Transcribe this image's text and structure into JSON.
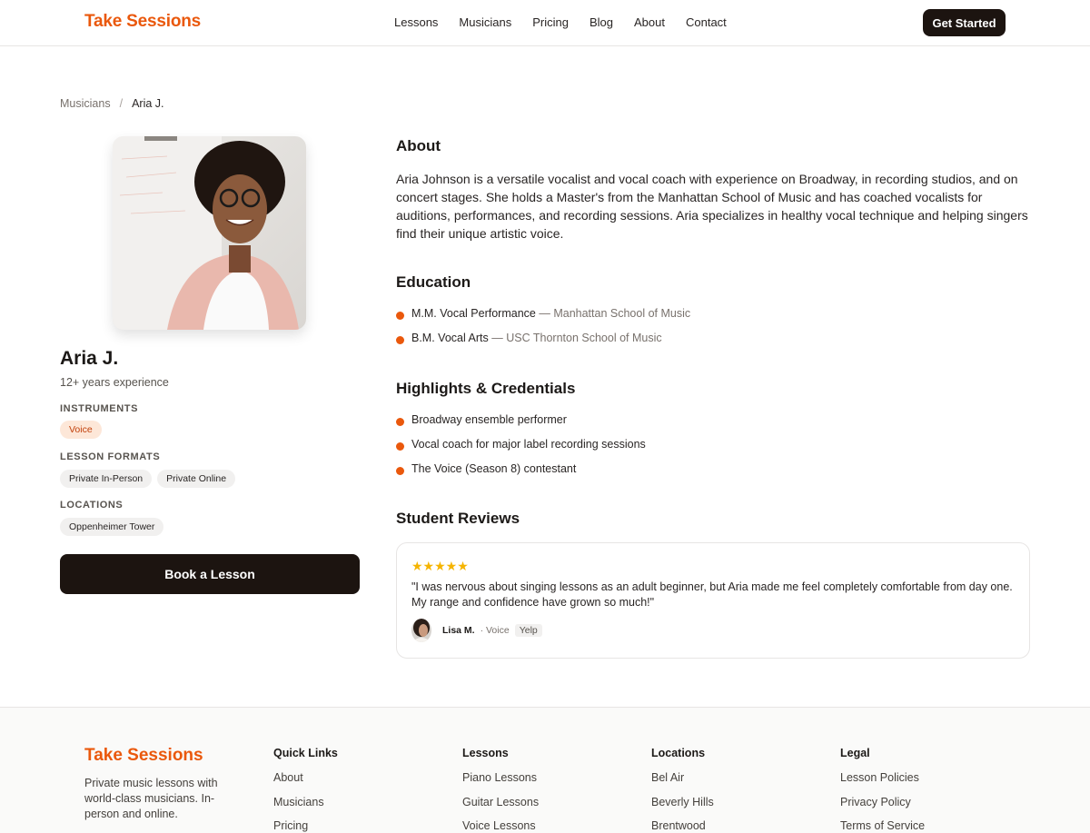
{
  "brand": "Take Sessions",
  "nav": [
    "Lessons",
    "Musicians",
    "Pricing",
    "Blog",
    "About",
    "Contact"
  ],
  "cta": "Get Started",
  "breadcrumb": {
    "parent": "Musicians",
    "sep": "/",
    "current": "Aria J."
  },
  "profile": {
    "name": "Aria J.",
    "experience": "12+ years experience",
    "instruments_label": "INSTRUMENTS",
    "instruments": [
      "Voice"
    ],
    "formats_label": "LESSON FORMATS",
    "formats": [
      "Private In-Person",
      "Private Online"
    ],
    "locations_label": "LOCATIONS",
    "locations": [
      "Oppenheimer Tower"
    ],
    "book_label": "Book a Lesson"
  },
  "about": {
    "heading": "About",
    "text": "Aria Johnson is a versatile vocalist and vocal coach with experience on Broadway, in recording studios, and on concert stages. She holds a Master's from the Manhattan School of Music and has coached vocalists for auditions, performances, and recording sessions. Aria specializes in healthy vocal technique and helping singers find their unique artistic voice."
  },
  "education": {
    "heading": "Education",
    "items": [
      {
        "degree": "M.M. Vocal Performance",
        "school": "Manhattan School of Music"
      },
      {
        "degree": "B.M. Vocal Arts",
        "school": "USC Thornton School of Music"
      }
    ]
  },
  "highlights": {
    "heading": "Highlights & Credentials",
    "items": [
      "Broadway ensemble performer",
      "Vocal coach for major label recording sessions",
      "The Voice (Season 8) contestant"
    ]
  },
  "reviews": {
    "heading": "Student Reviews",
    "items": [
      {
        "rating": 5,
        "stars": "★★★★★",
        "text": "\"I was nervous about singing lessons as an adult beginner, but Aria made me feel completely comfortable from day one. My range and confidence have grown so much!\"",
        "author": "Lisa M.",
        "context": "· Voice",
        "source": "Yelp"
      }
    ]
  },
  "footer": {
    "brand": "Take Sessions",
    "tagline": "Private music lessons with world-class musicians. In-person and online.",
    "columns": [
      {
        "title": "Quick Links",
        "links": [
          "About",
          "Musicians",
          "Pricing"
        ]
      },
      {
        "title": "Lessons",
        "links": [
          "Piano Lessons",
          "Guitar Lessons",
          "Voice Lessons"
        ]
      },
      {
        "title": "Locations",
        "links": [
          "Bel Air",
          "Beverly Hills",
          "Brentwood"
        ]
      },
      {
        "title": "Legal",
        "links": [
          "Lesson Policies",
          "Privacy Policy",
          "Terms of Service"
        ]
      }
    ]
  }
}
